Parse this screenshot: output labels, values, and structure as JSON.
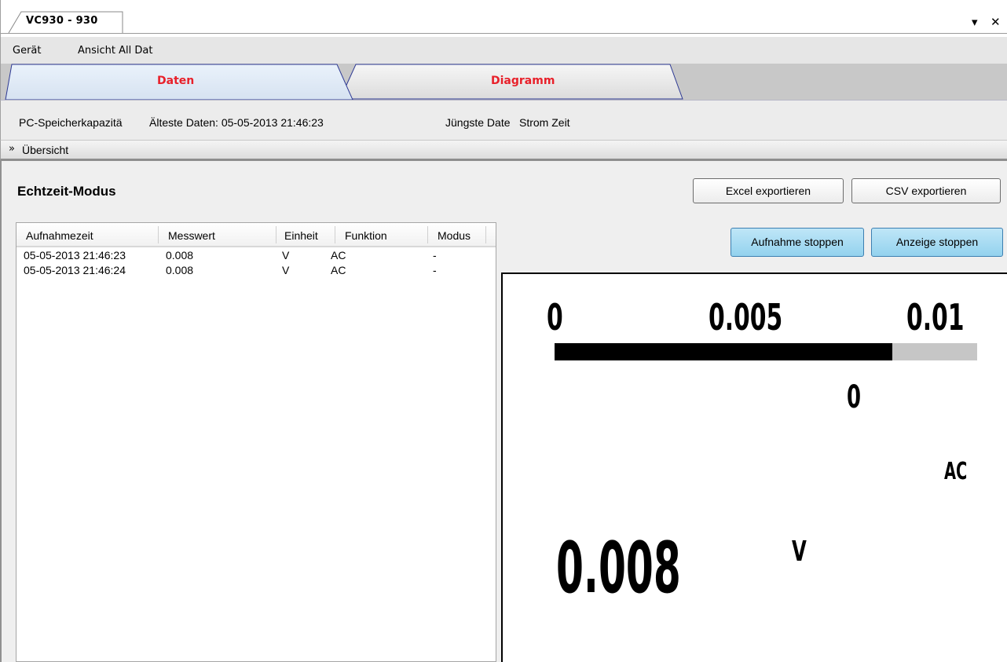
{
  "document_tab": {
    "title": "VC930 - 930",
    "menu_arrow": "▾",
    "close": "✕"
  },
  "menu": {
    "items": [
      "Gerät",
      "Ansicht All Dat"
    ]
  },
  "tabs": [
    {
      "label": "Daten",
      "active": true
    },
    {
      "label": "Diagramm",
      "active": false
    }
  ],
  "info": {
    "capacity": "PC-Speicherkapazitä",
    "oldest": "Älteste Daten: 05-05-2013 21:46:23",
    "newest": "Jüngste Date",
    "current_time": "Strom Zeit"
  },
  "overview": {
    "label": "Übersicht",
    "icon": "chevron-double-down-icon"
  },
  "main": {
    "section_title": "Echtzeit-Modus",
    "buttons": {
      "excel": "Excel exportieren",
      "csv": "CSV exportieren",
      "stop_recording": "Aufnahme stoppen",
      "stop_display": "Anzeige stoppen"
    }
  },
  "table": {
    "columns": [
      "Aufnahmezeit",
      "Messwert",
      "Einheit",
      "Funktion",
      "Modus"
    ],
    "rows": [
      [
        "05-05-2013 21:46:23",
        "0.008",
        "V",
        "AC",
        "-"
      ],
      [
        "05-05-2013 21:46:24",
        "0.008",
        "V",
        "AC",
        "-"
      ]
    ]
  },
  "display": {
    "scale_min": "0",
    "scale_mid": "0.005",
    "scale_max": "0.01",
    "bar_fraction": 0.8,
    "secondary": "0",
    "function": "AC",
    "value": "0.008",
    "unit": "V"
  },
  "colors": {
    "tab_label": "#e8202a",
    "button_blue": "#9ad5ef",
    "bar_fill": "#000000",
    "bar_track": "#c6c6c6"
  }
}
